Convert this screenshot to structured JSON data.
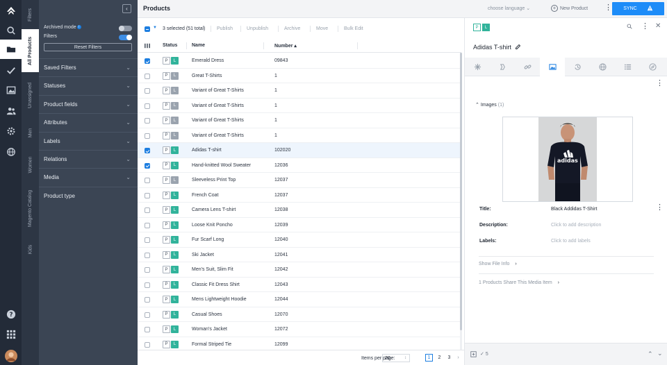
{
  "header": {
    "title": "Products",
    "language_placeholder": "choose language",
    "new_product": "New Product",
    "sync": "SYNC"
  },
  "vertical_tabs": [
    "Filters",
    "All Products",
    "Unassigned",
    "Men",
    "Women",
    "Magento Catalog",
    "Kids"
  ],
  "filters": {
    "archived_mode": "Archived mode",
    "archived_info": "i",
    "filters_label": "Filters",
    "reset": "Reset Filters",
    "sections": [
      "Saved Filters",
      "Statuses",
      "Product fields",
      "Attributes",
      "Labels",
      "Relations",
      "Media",
      "Product type"
    ]
  },
  "toolbar": {
    "selected": "3 selected (51 total)",
    "actions": [
      "Publish",
      "Unpublish",
      "Archive",
      "Move",
      "Bulk Edit"
    ]
  },
  "table": {
    "columns": {
      "status": "Status",
      "name": "Name",
      "number": "Number ▴"
    },
    "badge_p": "P",
    "badge_l": "L",
    "rows": [
      {
        "name": "Emerald Dress",
        "number": "09843",
        "checked": true,
        "l_green": true
      },
      {
        "name": "Great T-Shirts",
        "number": "1",
        "checked": false,
        "l_green": false
      },
      {
        "name": "Variant of Great T-Shirts",
        "number": "1",
        "checked": false,
        "l_green": false
      },
      {
        "name": "Variant of Great T-Shirts",
        "number": "1",
        "checked": false,
        "l_green": false
      },
      {
        "name": "Variant of Great T-Shirts",
        "number": "1",
        "checked": false,
        "l_green": false
      },
      {
        "name": "Variant of Great T-Shirts",
        "number": "1",
        "checked": false,
        "l_green": false
      },
      {
        "name": "Adidas T-shirt",
        "number": "102020",
        "checked": true,
        "l_green": true,
        "highlight": true
      },
      {
        "name": "Hand-knitted Wool Sweater",
        "number": "12036",
        "checked": true,
        "l_green": true
      },
      {
        "name": "Sleeveless Print Top",
        "number": "12037",
        "checked": false,
        "l_green": false
      },
      {
        "name": "French Coat",
        "number": "12037",
        "checked": false,
        "l_green": true
      },
      {
        "name": "Camera Lens T-shirt",
        "number": "12038",
        "checked": false,
        "l_green": true
      },
      {
        "name": "Loose Knit Poncho",
        "number": "12039",
        "checked": false,
        "l_green": true
      },
      {
        "name": "Fur Scarf Long",
        "number": "12040",
        "checked": false,
        "l_green": true
      },
      {
        "name": "Ski Jacket",
        "number": "12041",
        "checked": false,
        "l_green": true
      },
      {
        "name": "Men's Suit, Slim Fit",
        "number": "12042",
        "checked": false,
        "l_green": true
      },
      {
        "name": "Classic Fit Dress Shirt",
        "number": "12043",
        "checked": false,
        "l_green": true
      },
      {
        "name": "Mens Lightweight Hoodie",
        "number": "12044",
        "checked": false,
        "l_green": true
      },
      {
        "name": "Casual Shoes",
        "number": "12070",
        "checked": false,
        "l_green": true
      },
      {
        "name": "Woman's Jacket",
        "number": "12072",
        "checked": false,
        "l_green": true
      },
      {
        "name": "Formal Striped Tie",
        "number": "12099",
        "checked": false,
        "l_green": true
      }
    ]
  },
  "pager": {
    "label": "Items per page:",
    "per_page": "20",
    "pages": [
      "1",
      "2",
      "3"
    ],
    "next": "›"
  },
  "detail": {
    "title": "Adidas T-shirt",
    "images_label": "Images",
    "images_count": "(1)",
    "photo_text": "adidas",
    "fields": [
      {
        "label": "Title:",
        "value": "Black Addidas T-Shirt",
        "placeholder": false
      },
      {
        "label": "Description:",
        "value": "Click to add description",
        "placeholder": true
      },
      {
        "label": "Labels:",
        "value": "Click to add labels",
        "placeholder": true
      }
    ],
    "show_file_info": "Show File Info",
    "share_info": "1 Products Share This Media Item",
    "footer_count": "5"
  },
  "colors": {
    "accent": "#1d8cf8",
    "badge_green": "#31b39b",
    "rail_bg": "#232b38",
    "filter_bg": "#3b4554"
  }
}
